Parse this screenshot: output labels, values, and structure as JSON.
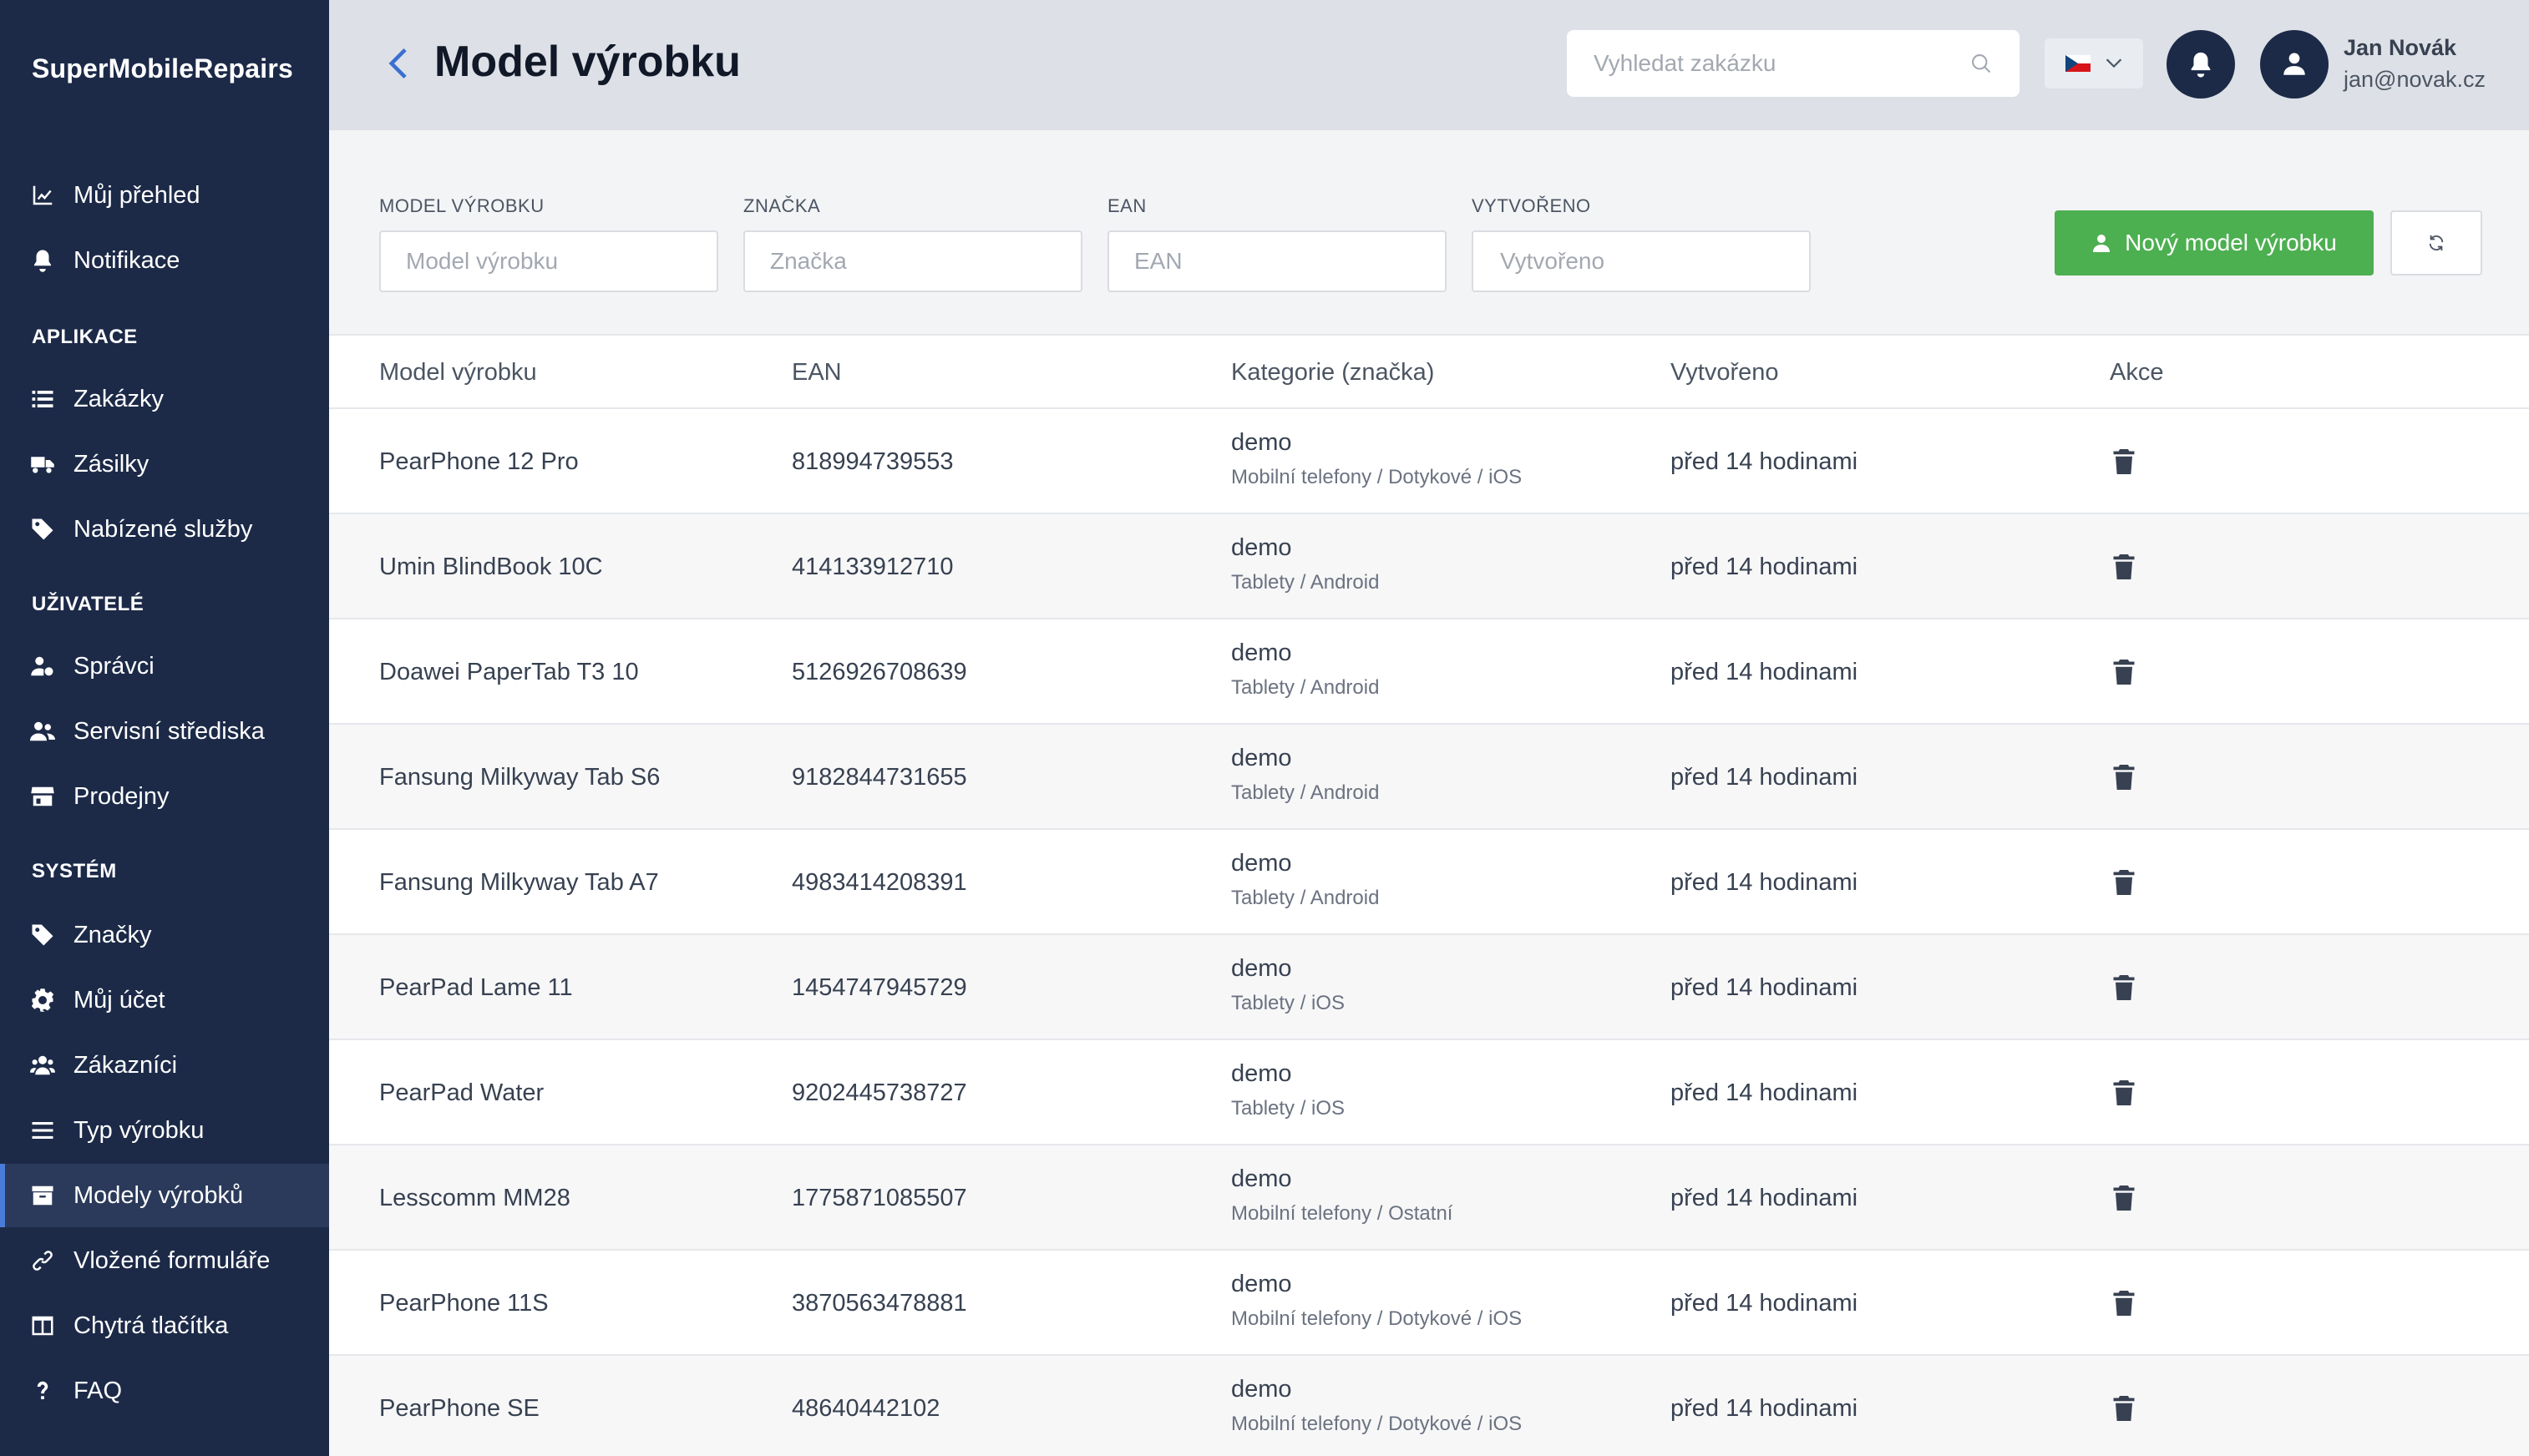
{
  "app": {
    "brand": "SuperMobileRepairs"
  },
  "sidebar": {
    "items_top": [
      {
        "label": "Můj přehled",
        "icon": "chart-line-icon"
      },
      {
        "label": "Notifikace",
        "icon": "bell-icon"
      }
    ],
    "section_apps": "APLIKACE",
    "items_apps": [
      {
        "label": "Zakázky",
        "icon": "list-icon"
      },
      {
        "label": "Zásilky",
        "icon": "truck-icon"
      },
      {
        "label": "Nabízené služby",
        "icon": "tag-icon"
      }
    ],
    "section_users": "UŽIVATELÉ",
    "items_users": [
      {
        "label": "Správci",
        "icon": "user-cog-icon"
      },
      {
        "label": "Servisní střediska",
        "icon": "users-icon"
      },
      {
        "label": "Prodejny",
        "icon": "store-icon"
      }
    ],
    "section_system": "SYSTÉM",
    "items_system": [
      {
        "label": "Značky",
        "icon": "tag-icon"
      },
      {
        "label": "Můj účet",
        "icon": "gear-icon"
      },
      {
        "label": "Zákazníci",
        "icon": "users-group-icon"
      },
      {
        "label": "Typ výrobku",
        "icon": "bars-icon"
      },
      {
        "label": "Modely výrobků",
        "icon": "archive-icon",
        "active": true
      },
      {
        "label": "Vložené formuláře",
        "icon": "link-icon"
      },
      {
        "label": "Chytrá tlačítka",
        "icon": "columns-icon"
      },
      {
        "label": "FAQ",
        "icon": "question-icon"
      }
    ]
  },
  "header": {
    "title": "Model výrobku",
    "search_placeholder": "Vyhledat zakázku",
    "user_name": "Jan Novák",
    "user_email": "jan@novak.cz"
  },
  "filters": {
    "model_label": "MODEL VÝROBKU",
    "model_placeholder": "Model výrobku",
    "brand_label": "ZNAČKA",
    "brand_placeholder": "Značka",
    "ean_label": "EAN",
    "ean_placeholder": "EAN",
    "created_label": "VYTVOŘENO",
    "created_placeholder": "Vytvořeno",
    "new_button": "Nový model výrobku"
  },
  "table": {
    "headers": {
      "model": "Model výrobku",
      "ean": "EAN",
      "category": "Kategorie (značka)",
      "created": "Vytvořeno",
      "actions": "Akce"
    },
    "rows": [
      {
        "model": "PearPhone 12 Pro",
        "ean": "818994739553",
        "brand": "demo",
        "category": "Mobilní telefony / Dotykové / iOS",
        "created": "před 14 hodinami"
      },
      {
        "model": "Umin BlindBook 10C",
        "ean": "414133912710",
        "brand": "demo",
        "category": "Tablety / Android",
        "created": "před 14 hodinami"
      },
      {
        "model": "Doawei PaperTab T3 10",
        "ean": "5126926708639",
        "brand": "demo",
        "category": "Tablety / Android",
        "created": "před 14 hodinami"
      },
      {
        "model": "Fansung Milkyway Tab S6",
        "ean": "9182844731655",
        "brand": "demo",
        "category": "Tablety / Android",
        "created": "před 14 hodinami"
      },
      {
        "model": "Fansung Milkyway Tab A7",
        "ean": "4983414208391",
        "brand": "demo",
        "category": "Tablety / Android",
        "created": "před 14 hodinami"
      },
      {
        "model": "PearPad Lame 11",
        "ean": "1454747945729",
        "brand": "demo",
        "category": "Tablety / iOS",
        "created": "před 14 hodinami"
      },
      {
        "model": "PearPad Water",
        "ean": "9202445738727",
        "brand": "demo",
        "category": "Tablety / iOS",
        "created": "před 14 hodinami"
      },
      {
        "model": "Lesscomm MM28",
        "ean": "1775871085507",
        "brand": "demo",
        "category": "Mobilní telefony / Ostatní",
        "created": "před 14 hodinami"
      },
      {
        "model": "PearPhone 11S",
        "ean": "3870563478881",
        "brand": "demo",
        "category": "Mobilní telefony / Dotykové / iOS",
        "created": "před 14 hodinami"
      },
      {
        "model": "PearPhone SE",
        "ean": "48640442102",
        "brand": "demo",
        "category": "Mobilní telefony / Dotykové / iOS",
        "created": "před 14 hodinami"
      }
    ]
  },
  "colors": {
    "sidebar_bg": "#1c2a48",
    "accent_blue": "#4a7bd8",
    "primary_green": "#4caf50"
  }
}
